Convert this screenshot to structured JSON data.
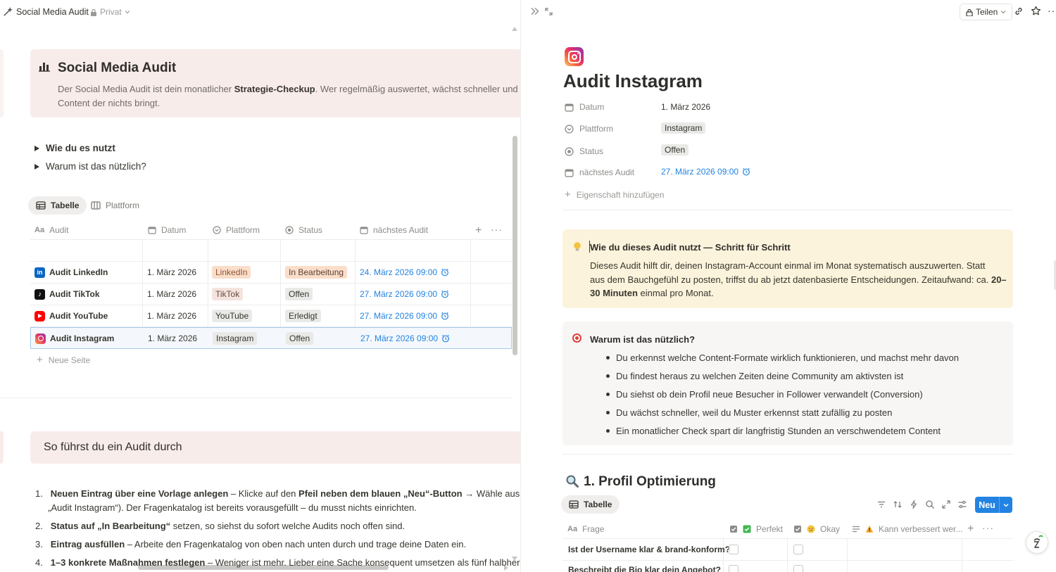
{
  "topbar": {
    "page_title": "Social Media Audit",
    "privacy_label": "Privat",
    "share_label": "Teilen"
  },
  "left": {
    "callout": {
      "title": "Social Media Audit",
      "line1_pre": "Der Social Media Audit ist dein monatlicher ",
      "line1_bold": "Strategie-Checkup",
      "line1_post": ". Wer regelmäßig auswertet, wächst schneller und",
      "line2": "Content der nichts bringt."
    },
    "toggles": [
      "Wie du es nutzt",
      "Warum ist das nützlich?"
    ],
    "views": [
      {
        "label": "Tabelle"
      },
      {
        "label": "Plattform"
      }
    ],
    "columns": [
      "Audit",
      "Datum",
      "Plattform",
      "Status",
      "nächstes Audit"
    ],
    "rows": [
      {
        "name": "Audit LinkedIn",
        "date": "1. März 2026",
        "platform": "LinkedIn",
        "status": "In Bearbeitung",
        "next": "24. März 2026 09:00"
      },
      {
        "name": "Audit TikTok",
        "date": "1. März 2026",
        "platform": "TikTok",
        "status": "Offen",
        "next": "27. März 2026 09:00"
      },
      {
        "name": "Audit YouTube",
        "date": "1. März 2026",
        "platform": "YouTube",
        "status": "Erledigt",
        "next": "27. März 2026 09:00"
      },
      {
        "name": "Audit Instagram",
        "date": "1. März 2026",
        "platform": "Instagram",
        "status": "Offen",
        "next": "27. März 2026 09:00"
      }
    ],
    "new_page_label": "Neue Seite",
    "section2_title": "So führst du ein Audit durch",
    "steps": [
      {
        "num": "1.",
        "b1": "Neuen Eintrag über eine Vorlage anlegen",
        "t1": " – Klicke auf den ",
        "b2": "Pfeil neben dem blauen „Neu“-Button",
        "t2": " → Wähle aus den",
        "line2": "„Audit Instagram“). Der Fragenkatalog ist bereits vorausgefüllt – du musst nichts einrichten."
      },
      {
        "num": "2.",
        "b1": "Status auf „In Bearbeitung“",
        "t1": " setzen, so siehst du sofort welche Audits noch offen sind."
      },
      {
        "num": "3.",
        "b1": "Eintrag ausfüllen",
        "t1": " – Arbeite den Fragenkatalog von oben nach unten durch und trage deine Daten ein."
      },
      {
        "num": "4.",
        "b1": "1–3 konkrete Maßnahmen festlegen",
        "t1": " – Weniger ist mehr. Lieber eine Sache konsequent umsetzen als fünf halbherzig."
      }
    ]
  },
  "right": {
    "page_title": "Audit Instagram",
    "properties": [
      {
        "label": "Datum",
        "value": "1. März 2026"
      },
      {
        "label": "Plattform",
        "value": "Instagram"
      },
      {
        "label": "Status",
        "value": "Offen"
      },
      {
        "label": "nächstes Audit",
        "value": "27. März 2026 09:00"
      }
    ],
    "add_property_label": "Eigenschaft hinzufügen",
    "callout1": {
      "title": "Wie du dieses Audit nutzt — Schritt für Schritt",
      "line1": "Dieses Audit hilft dir, deinen Instagram-Account einmal im Monat systematisch auszuwerten. Statt",
      "line2_pre": "aus dem Bauchgefühl zu posten, triffst du ab jetzt datenbasierte Entscheidungen. Zeitaufwand: ca. ",
      "line2_bold": "20–",
      "line3_bold": "30 Minuten",
      "line3_post": " einmal pro Monat."
    },
    "callout2": {
      "title": "Warum ist das nützlich?",
      "bullets": [
        "Du erkennst welche Content-Formate wirklich funktionieren, und machst mehr davon",
        "Du findest heraus zu welchen Zeiten deine Community am aktivsten ist",
        "Du siehst ob dein Profil neue Besucher in Follower verwandelt (Conversion)",
        "Du wächst schneller, weil du Muster erkennst statt zufällig zu posten",
        "Ein monatlicher Check spart dir langfristig Stunden an verschwendetem Content"
      ]
    },
    "section_title": "1. Profil Optimierung",
    "view_label": "Tabelle",
    "new_button_label": "Neu",
    "db_columns": [
      "Frage",
      "Perfekt",
      "Okay",
      "Kann verbessert wer..."
    ],
    "db_rows": [
      "Ist der Username klar & brand-konform?",
      "Beschreibt die Bio klar dein Angebot?"
    ]
  },
  "colors": {
    "accent": "#2383e2",
    "callout_pink": "#f8ecea",
    "callout_yellow": "#fbf3db",
    "callout_grey": "#f7f6f5",
    "tag_orange": "#fadec9",
    "tag_grey": "#e9e9e7"
  }
}
